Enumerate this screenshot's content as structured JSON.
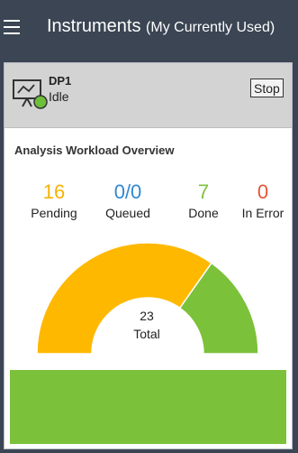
{
  "header": {
    "title": "Instruments",
    "subtitle": "(My Currently Used)",
    "menu_icon": "hamburger-menu-icon",
    "background_color": "#3b4553"
  },
  "instrument": {
    "name": "DP1",
    "status": "Idle",
    "icon": "instrument-status-icon",
    "status_dot_color": "#6dbf3a",
    "stop_label": "Stop"
  },
  "workload": {
    "title": "Analysis Workload Overview",
    "stats": [
      {
        "value": "16",
        "label": "Pending",
        "color": "#f5b400"
      },
      {
        "value": "0/0",
        "label": "Queued",
        "color": "#2f89d1"
      },
      {
        "value": "7",
        "label": "Done",
        "color": "#7cc13a"
      },
      {
        "value": "0",
        "label": "In Error",
        "color": "#e5553a"
      }
    ],
    "total_value": "23",
    "total_label": "Total"
  },
  "chart_data": {
    "type": "gauge",
    "segments": [
      {
        "name": "Pending",
        "value": 16,
        "color": "#ffb800"
      },
      {
        "name": "Done",
        "value": 7,
        "color": "#7cc13a"
      }
    ],
    "total": 23
  },
  "status_bar_color": "#7cc13a"
}
